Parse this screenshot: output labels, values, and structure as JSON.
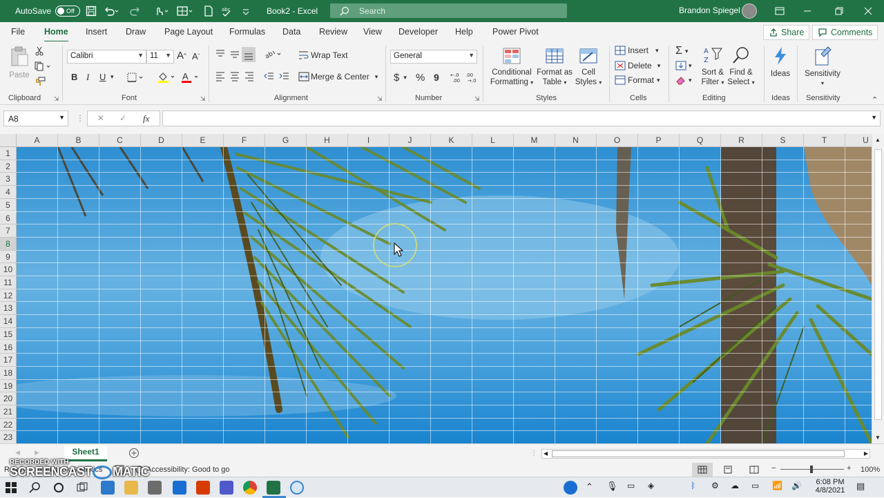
{
  "title_bar": {
    "autosave_label": "AutoSave",
    "autosave_state": "Off",
    "doc_title": "Book2  -  Excel",
    "search_placeholder": "Search",
    "user_name": "Brandon Spiegel"
  },
  "menu": {
    "tabs": [
      "File",
      "Home",
      "Insert",
      "Draw",
      "Page Layout",
      "Formulas",
      "Data",
      "Review",
      "View",
      "Developer",
      "Help",
      "Power Pivot"
    ],
    "active": "Home",
    "share": "Share",
    "comments": "Comments"
  },
  "ribbon": {
    "clipboard": {
      "label": "Clipboard",
      "paste": "Paste"
    },
    "font": {
      "label": "Font",
      "font_name": "Calibri",
      "font_size": "11",
      "bold": "B",
      "italic": "I",
      "underline": "U"
    },
    "alignment": {
      "label": "Alignment",
      "wrap_text": "Wrap Text",
      "merge_center": "Merge & Center"
    },
    "number": {
      "label": "Number",
      "format": "General",
      "currency": "$",
      "percent": "%",
      "comma": "9"
    },
    "styles": {
      "label": "Styles",
      "conditional_1": "Conditional",
      "conditional_2": "Formatting",
      "format_as_1": "Format as",
      "format_as_2": "Table",
      "cell_styles_1": "Cell",
      "cell_styles_2": "Styles"
    },
    "cells": {
      "label": "Cells",
      "insert": "Insert",
      "delete": "Delete",
      "format": "Format"
    },
    "editing": {
      "label": "Editing",
      "sort_1": "Sort &",
      "sort_2": "Filter",
      "find_1": "Find &",
      "find_2": "Select"
    },
    "ideas": {
      "label": "Ideas",
      "button": "Ideas"
    },
    "sensitivity": {
      "label": "Sensitivity",
      "button": "Sensitivity"
    }
  },
  "formula_bar": {
    "name_box": "A8",
    "fx": "fx",
    "formula": ""
  },
  "grid": {
    "columns": [
      "A",
      "B",
      "C",
      "D",
      "E",
      "F",
      "G",
      "H",
      "I",
      "J",
      "K",
      "L",
      "M",
      "N",
      "O",
      "P",
      "Q",
      "R",
      "S",
      "T",
      "U"
    ],
    "rows": [
      "1",
      "2",
      "3",
      "4",
      "5",
      "6",
      "7",
      "8",
      "9",
      "10",
      "11",
      "12",
      "13",
      "14",
      "15",
      "16",
      "17",
      "18",
      "19",
      "20",
      "21",
      "22",
      "23"
    ],
    "selected_row": "8"
  },
  "sheets": {
    "tabs": [
      "Sheet1"
    ],
    "active": "Sheet1"
  },
  "status": {
    "ready": "Ready",
    "workbook_statistics": "Workbook Statistics",
    "accessibility": "Accessibility: Good to go",
    "zoom": "100%"
  },
  "watermark": {
    "line1": "RECORDED WITH",
    "line2": "SCREENCAST",
    "line3": "MATIC"
  },
  "taskbar": {
    "time": "6:08 PM",
    "date": "4/8/2021"
  },
  "colors": {
    "excel_green": "#217346",
    "sky_blue": "#4aa3dc"
  }
}
